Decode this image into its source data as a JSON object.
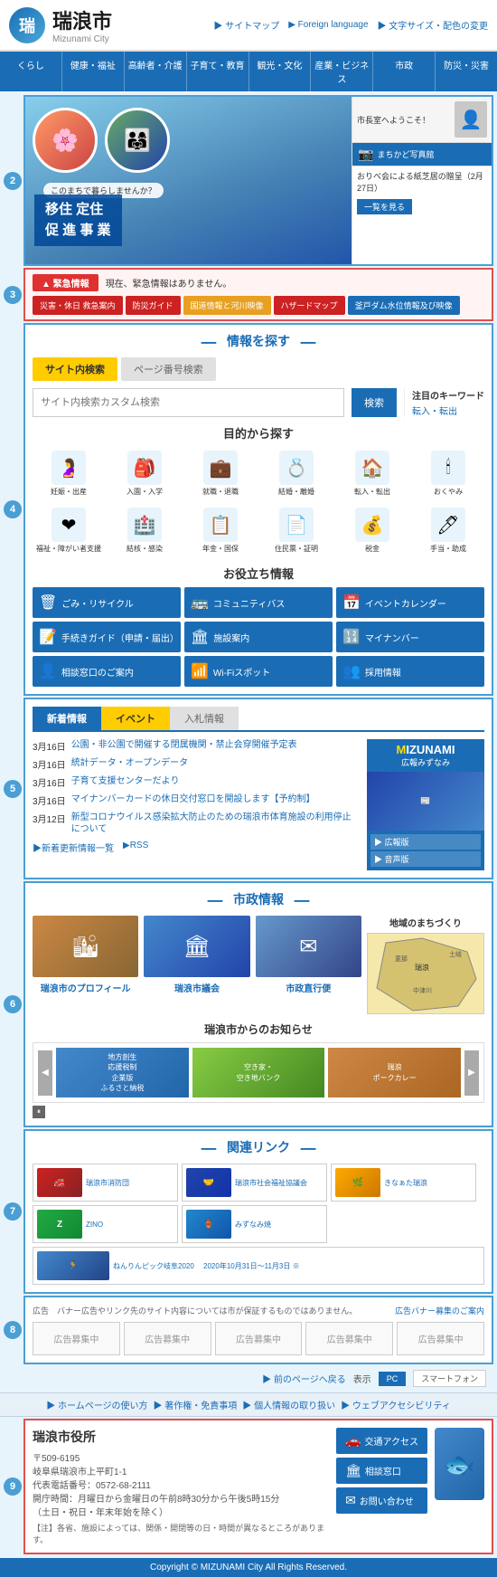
{
  "header": {
    "logo_char": "瑞",
    "city_name": "瑞浪市",
    "city_name_en": "Mizunami City",
    "links": [
      "サイトマップ",
      "Foreign language",
      "文字サイズ・配色の変更"
    ]
  },
  "nav": {
    "items": [
      "くらし",
      "健康・福祉",
      "高齢者・介護",
      "子育て・教育",
      "観光・文化",
      "産業・ビジネス",
      "市政",
      "防災・災害"
    ]
  },
  "hero": {
    "tag": "このまちで暮らしませんか？",
    "title_line1": "移住 定住",
    "title_line2": "促 進 事 業",
    "mayor_label": "市長室へようこそ！",
    "photo_label": "まちかど写真館",
    "news_text": "おりべ会による紙芝居の贈呈（2月27日）",
    "list_btn": "一覧を見る"
  },
  "emergency": {
    "badge": "▲ 緊急情報",
    "message": "現在、緊急情報はありません。",
    "links": [
      {
        "label": "災害・休日 救急案内",
        "color": "red"
      },
      {
        "label": "防災ガイド",
        "color": "red"
      },
      {
        "label": "国道情報と河川映像",
        "color": "yellow"
      },
      {
        "label": "ハザードマップ",
        "color": "red"
      },
      {
        "label": "釜戸ダム水位情報及び映像",
        "color": "blue"
      }
    ]
  },
  "search": {
    "section_title": "情報を探す",
    "tabs": [
      "サイト内検索",
      "ページ番号検索"
    ],
    "input_placeholder": "サイト内検索カスタム検索",
    "search_btn": "検索",
    "keywords_title": "注目のキーワード",
    "keywords": [
      "転入・転出"
    ],
    "purpose_title": "目的から探す",
    "purposes": [
      {
        "label": "妊娠・出産",
        "icon": "🤰"
      },
      {
        "label": "入園・入学",
        "icon": "🎒"
      },
      {
        "label": "就職・退職",
        "icon": "💼"
      },
      {
        "label": "結婚・離婚",
        "icon": "💍"
      },
      {
        "label": "転入・転出",
        "icon": "🏠"
      },
      {
        "label": "おくやみ",
        "icon": "🕯"
      },
      {
        "label": "福祉・障がい者支援",
        "icon": "❤"
      },
      {
        "label": "結核・感染",
        "icon": "🏥"
      },
      {
        "label": "年金・国保",
        "icon": "📋"
      },
      {
        "label": "住民票・証明",
        "icon": "📄"
      },
      {
        "label": "税金",
        "icon": "💰"
      },
      {
        "label": "手当・助成",
        "icon": "🖊"
      }
    ],
    "useful_title": "お役立ち情報",
    "useful": [
      {
        "label": "ごみ・リサイクル",
        "icon": "🗑"
      },
      {
        "label": "コミュニティバス",
        "icon": "🚌"
      },
      {
        "label": "イベントカレンダー",
        "icon": "📅"
      },
      {
        "label": "手続きガイド（申請・届出）",
        "icon": "📝"
      },
      {
        "label": "施設案内",
        "icon": "🏛"
      },
      {
        "label": "マイナンバー",
        "icon": "🔢"
      },
      {
        "label": "相談窓口のご案内",
        "icon": "👤"
      },
      {
        "label": "Wi-Fiスポット",
        "icon": "📶"
      },
      {
        "label": "採用情報",
        "icon": "👥"
      }
    ]
  },
  "news": {
    "tabs": [
      "新着情報",
      "イベント",
      "入札情報"
    ],
    "items": [
      {
        "date": "3月16日",
        "text": "公園・非公園で開催する閉属機関・禁止会穿開催予定表"
      },
      {
        "date": "3月16日",
        "text": "統計データ・オープンデータ"
      },
      {
        "date": "3月16日",
        "text": "子育て支援センターだより"
      },
      {
        "date": "3月16日",
        "text": "マイナンバーカードの休日交付窓口を開設します【予約制】"
      },
      {
        "date": "3月12日",
        "text": "新型コロナウイルス感染拡大防止のための瑞浪市体育施設の利用停止について"
      }
    ],
    "more_link": "▶新着更新情報一覧",
    "rss": "▶RSS",
    "magazine": {
      "title": "MIZUNAMI",
      "subtitle": "広報みずなみ",
      "links": [
        "広報版",
        "音声版"
      ]
    }
  },
  "cityinfo": {
    "title": "市政情報",
    "items": [
      {
        "label": "瑞浪市のプロフィール",
        "img": "🏙"
      },
      {
        "label": "瑞浪市議会",
        "img": "🏛"
      },
      {
        "label": "市政直行便",
        "img": "✉"
      }
    ],
    "map_title": "地域のまちづくり",
    "news_subtitle": "瑞浪市からのお知らせ",
    "slide_items": [
      {
        "label": "地方創生\n応援税制\n企業版\nふるさと納税"
      },
      {
        "label": "空き家・\n空き地バンク"
      },
      {
        "label": "瑞浪\nポークカレー"
      }
    ]
  },
  "related": {
    "title": "関連リンク",
    "items": [
      {
        "label": "瑞浪市消防団",
        "icon": "🔥"
      },
      {
        "label": "瑞浪市社会福祉協議会",
        "icon": "🤝"
      },
      {
        "label": "きなぁた瑞浪",
        "icon": "🌿"
      },
      {
        "label": "ZINO",
        "icon": "Z"
      },
      {
        "label": "みずなみ焼",
        "icon": "🏺"
      },
      {
        "label": "ねんりんピック岐阜2020\n2020年10月31日～11月3日 ※"
      }
    ]
  },
  "ad": {
    "notice": "広告　バナー広告やリンク先のサイト内容については市が保証するものではありません。",
    "notice_link": "広告バナー募集のご案内",
    "items": [
      "広告募集中",
      "広告募集中",
      "広告募集中",
      "広告募集中",
      "広告募集中"
    ]
  },
  "back_top": {
    "link": "▶ 前のページへ戻る",
    "view_label": "表示",
    "view_options": [
      "PC",
      "スマートフォン"
    ]
  },
  "footer_nav": {
    "items": [
      "ホームページの使い方",
      "著作権・免責事項",
      "個人情報の取り扱い",
      "ウェブアクセシビリティ"
    ]
  },
  "footer": {
    "city_name": "瑞浪市役所",
    "postal": "〒509-6195",
    "address": "岐阜県瑞浪市上平町1-1",
    "tel_label": "代表電話番号",
    "tel": "0572-68-2111",
    "hours": "開庁時間：月曜日から金曜日の午前8時30分から午後5時15分",
    "days": "（土日・祝日・年末年始を除く）",
    "note": "【注】各省、施設によっては、関係・開閉等の日・時間が異なるところがあります。",
    "buttons": [
      "交通アクセス",
      "相談窓口",
      "お問い合わせ"
    ],
    "copyright": "Copyright © MIZUNAMI City All Rights Reserved."
  }
}
